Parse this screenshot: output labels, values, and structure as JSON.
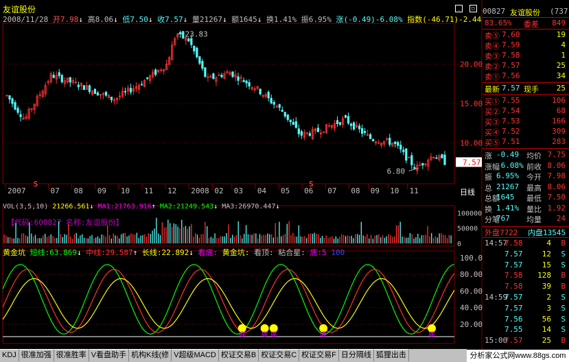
{
  "window": {
    "title": "友谊股份",
    "buttons": [
      "_",
      "□",
      "×"
    ]
  },
  "ohlc_bar": {
    "date": "2008/11/28",
    "open": "开7.98",
    "high": "高8.06",
    "low": "低7.50",
    "close": "收7.57",
    "volume": "量21267",
    "amount": "额1645",
    "turnover": "换1.41%",
    "amplitude": "振6.95%",
    "change": "涨(-0.49)-6.08%",
    "index": "指数(-46.71)-2.44"
  },
  "price_chart": {
    "y_ticks": [
      "20.00",
      "15.00",
      "10.00"
    ],
    "high_mark": "23.83",
    "low_mark": "6.80",
    "last_price_tag": "7.57",
    "x_ticks": [
      "2007",
      "07",
      "08",
      "09",
      "10",
      "11",
      "12",
      "2008",
      "02",
      "03",
      "04",
      "05",
      "06",
      "07",
      "08",
      "09",
      "10",
      "11"
    ],
    "period_label": "日线",
    "s_markers": [
      "S",
      "S"
    ]
  },
  "volume_panel": {
    "label": "VOL(3,5,10)",
    "vol": "21266.561",
    "ma1": "MA1:21763.916",
    "ma2": "MA2:21249.543",
    "ma3": "MA3:26970.447",
    "overlay": "【代码:600827 名称:友谊股份】",
    "y_ticks": [
      "100000",
      "50000",
      "0"
    ]
  },
  "indicator_panel": {
    "name": "黄金坑",
    "short": "短线:63.869",
    "mid": "中线:29.587",
    "long": "长线:22.892",
    "see_bottom": "看底:",
    "pit": "黄金坑:",
    "see_top": "看顶:",
    "merge": "粘合星:",
    "bottom": "底:5",
    "extra": "100",
    "y_ticks": [
      "100.00",
      "80.00",
      "60.00",
      "40.00",
      "20.00"
    ],
    "bottom_tags": [
      "底",
      "底",
      "底",
      "底",
      "底"
    ]
  },
  "quote": {
    "header_code": "00827",
    "header_name": "友谊股份",
    "header_tail": "(737",
    "weibi": "委比",
    "weibi_val": "83.65%",
    "weicha": "委差",
    "weicha_val": "849",
    "asks": [
      {
        "label": "卖⑤",
        "price": "7.60",
        "qty": "19"
      },
      {
        "label": "卖④",
        "price": "7.59",
        "qty": "4"
      },
      {
        "label": "卖③",
        "price": "7.58",
        "qty": "1"
      },
      {
        "label": "卖②",
        "price": "7.57",
        "qty": "25"
      },
      {
        "label": "卖①",
        "price": "7.56",
        "qty": "34"
      }
    ],
    "last": {
      "label": "最新",
      "price": "7.57",
      "label2": "现手",
      "qty": "25"
    },
    "bids": [
      {
        "label": "买①",
        "price": "7.55",
        "qty": "106"
      },
      {
        "label": "买②",
        "price": "7.54",
        "qty": "68"
      },
      {
        "label": "买③",
        "price": "7.53",
        "qty": "166"
      },
      {
        "label": "买④",
        "price": "7.52",
        "qty": "309"
      },
      {
        "label": "买⑤",
        "price": "7.51",
        "qty": "283"
      }
    ],
    "stats": [
      {
        "l1": "涨",
        "v1": "-0.49",
        "l2": "均价",
        "v2": "7.75"
      },
      {
        "l1": "涨幅",
        "v1": "-6.08%",
        "l2": "前收",
        "v2": "8.06"
      },
      {
        "l1": "振",
        "v1": "6.95%",
        "l2": "今开",
        "v2": "7.98"
      },
      {
        "l1": "总",
        "v1": "21267",
        "l2": "最高",
        "v2": "8.06"
      },
      {
        "l1": "总额",
        "v1": "1645",
        "l2": "最低",
        "v2": "7.50"
      },
      {
        "l1": "换",
        "v1": "1.41%",
        "l2": "量比",
        "v2": "1.92"
      },
      {
        "l1": "分笔",
        "v1": "767",
        "l2": "均量",
        "v2": "24"
      }
    ],
    "outer": "外盘7722",
    "inner": "内盘13545",
    "ticks": [
      {
        "time": "14:57",
        "price": "7.58",
        "qty": "4",
        "side": "B"
      },
      {
        "time": "",
        "price": "7.57",
        "qty": "12",
        "side": "S"
      },
      {
        "time": "",
        "price": "7.57",
        "qty": "15",
        "side": "S"
      },
      {
        "time": "",
        "price": "7.58",
        "qty": "128",
        "side": "B"
      },
      {
        "time": "",
        "price": "7.58",
        "qty": "39",
        "side": "B"
      },
      {
        "time": "14:59",
        "price": "7.57",
        "qty": "2",
        "side": "S"
      },
      {
        "time": "",
        "price": "7.57",
        "qty": "3",
        "side": "S"
      },
      {
        "time": "",
        "price": "7.56",
        "qty": "56",
        "side": "S"
      },
      {
        "time": "",
        "price": "7.55",
        "qty": "14",
        "side": "S"
      },
      {
        "time": "15:00",
        "price": "7.57",
        "qty": "25",
        "side": "B"
      }
    ]
  },
  "tabs": [
    "KDJ",
    "很准加强",
    "很准胜率",
    "V看盘助手",
    "机构K线(修",
    "V超级MACD",
    "权证交易B",
    "权证交易C",
    "权证交易F",
    "日分隔线",
    "狐狸出击"
  ],
  "brand": "分析家公式网www.88gs.com",
  "colors": {
    "up": "#ff3232",
    "down": "#54fcfc",
    "grid": "#800000",
    "yellow": "#ffff00",
    "green": "#00ff00",
    "magenta": "#ff00ff"
  }
}
